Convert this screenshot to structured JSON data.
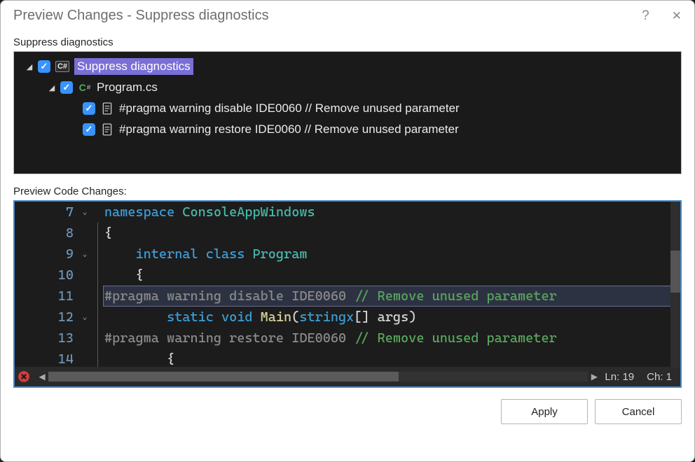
{
  "title": "Preview Changes - Suppress diagnostics",
  "sections": {
    "tree_label": "Suppress diagnostics",
    "preview_label": "Preview Code Changes:"
  },
  "tree": {
    "root": {
      "label": "Suppress diagnostics",
      "checked": true,
      "expanded": true
    },
    "file": {
      "label": "Program.cs",
      "checked": true,
      "expanded": true
    },
    "items": [
      {
        "label": "#pragma warning disable IDE0060 // Remove unused parameter",
        "checked": true
      },
      {
        "label": "#pragma warning restore IDE0060 // Remove unused parameter",
        "checked": true
      }
    ]
  },
  "code": {
    "lines": [
      {
        "num": "7",
        "fold": "v",
        "rule": false,
        "tokens": [
          [
            "kw",
            "namespace "
          ],
          [
            "type",
            "ConsoleAppWindows"
          ]
        ]
      },
      {
        "num": "8",
        "fold": "",
        "rule": true,
        "tokens": [
          [
            "punc",
            "{"
          ]
        ]
      },
      {
        "num": "9",
        "fold": "v",
        "rule": true,
        "tokens": [
          [
            "punc",
            "    "
          ],
          [
            "kw",
            "internal class "
          ],
          [
            "type",
            "Program"
          ]
        ]
      },
      {
        "num": "10",
        "fold": "",
        "rule": true,
        "tokens": [
          [
            "punc",
            "    {"
          ]
        ]
      },
      {
        "num": "11",
        "fold": "",
        "rule": true,
        "highlight": true,
        "tokens": [
          [
            "gray",
            "#pragma warning disable IDE0060 "
          ],
          [
            "comment",
            "// Remove unused parameter"
          ]
        ]
      },
      {
        "num": "12",
        "fold": "v",
        "rule": true,
        "tokens": [
          [
            "punc",
            "        "
          ],
          [
            "kw",
            "static void "
          ],
          [
            "func",
            "Main"
          ],
          [
            "punc",
            "("
          ],
          [
            "kw",
            "stringx"
          ],
          [
            "punc",
            "[] args)"
          ]
        ]
      },
      {
        "num": "13",
        "fold": "",
        "rule": true,
        "tokens": [
          [
            "gray",
            "#pragma warning restore IDE0060 "
          ],
          [
            "comment",
            "// Remove unused parameter"
          ]
        ]
      },
      {
        "num": "14",
        "fold": "",
        "rule": true,
        "tokens": [
          [
            "punc",
            "        {"
          ]
        ]
      }
    ]
  },
  "status": {
    "line": "Ln: 19",
    "col": "Ch: 1"
  },
  "buttons": {
    "apply": "Apply",
    "cancel": "Cancel"
  }
}
